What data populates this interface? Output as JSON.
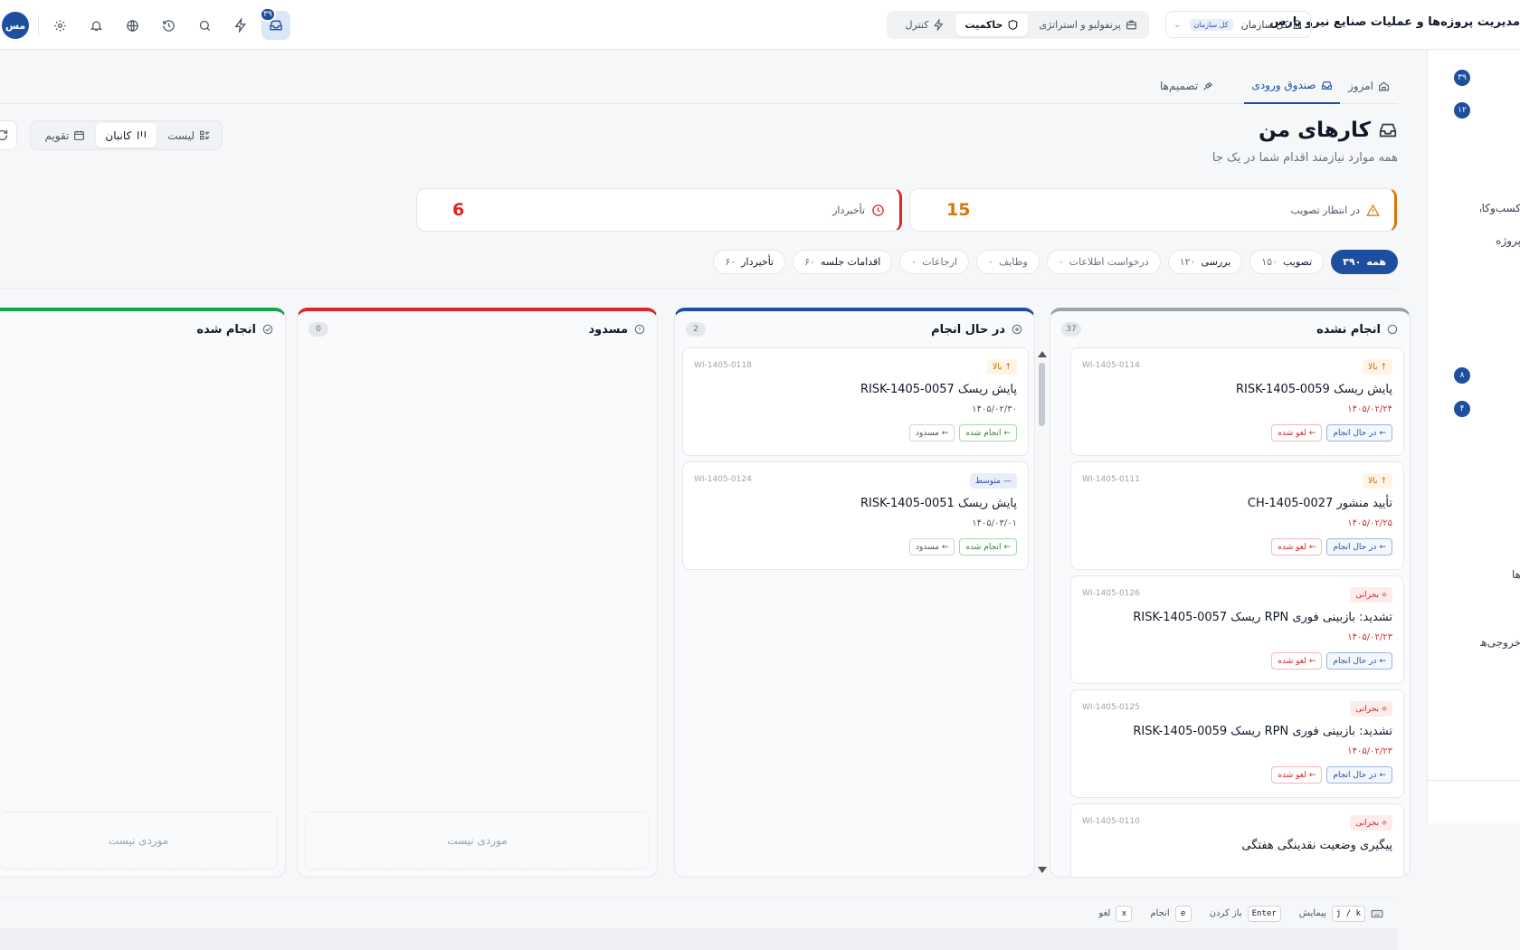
{
  "header": {
    "app_title": "مدیریت پروژه‌ها و عملیات صنایع نیرو پارس",
    "scope_label": "کل سازمان",
    "scope_chip": "کل سازمان",
    "modes": [
      {
        "label": "پرتفولیو و استراتژی",
        "icon": "briefcase-icon"
      },
      {
        "label": "حاکمیت",
        "icon": "shield-icon"
      },
      {
        "label": "کنترل",
        "icon": "bolt-icon"
      }
    ],
    "active_mode": "حاکمیت",
    "inbox_badge": "۳۹",
    "avatar_initials": "مس",
    "icons": [
      "inbox-icon",
      "bolt-icon",
      "search-icon",
      "history-icon",
      "globe-icon",
      "bell-icon",
      "gear-icon"
    ]
  },
  "sidepanel": {
    "badges": [
      "۳۹",
      "۱۲",
      "۸",
      "۴"
    ],
    "texts": [
      "کسب‌وکار",
      "پروژه",
      "ها",
      "خروجی‌ها"
    ]
  },
  "tabs": [
    {
      "label": "امروز",
      "icon": "home-icon"
    },
    {
      "label": "صندوق ورودی",
      "icon": "inbox-icon"
    },
    {
      "label": "تصمیم‌ها",
      "icon": "gavel-icon"
    }
  ],
  "active_tab": "صندوق ورودی",
  "page": {
    "title": "کارهای من",
    "subtitle": "همه موارد نیازمند اقدام شما در یک جا"
  },
  "view_switch": {
    "options": [
      "لیست",
      "کانبان",
      "تقویم"
    ],
    "active": "کانبان"
  },
  "stats": [
    {
      "label": "در انتظار تصویب",
      "value": "15",
      "color": "#d97706",
      "icon": "warning-icon"
    },
    {
      "label": "تأخیردار",
      "value": "6",
      "color": "#dc2626",
      "icon": "clock-icon"
    }
  ],
  "filters": [
    {
      "label": "همه",
      "count": "۳۹۰"
    },
    {
      "label": "تصویب",
      "count": "۱۵۰"
    },
    {
      "label": "بررسی",
      "count": "۱۲۰"
    },
    {
      "label": "درخواست اطلاعات",
      "count": "۰"
    },
    {
      "label": "وظایف",
      "count": "۰"
    },
    {
      "label": "ارجاعات",
      "count": "۰"
    },
    {
      "label": "اقدامات جلسه",
      "count": "۶۰"
    },
    {
      "label": "تأخیردار",
      "count": "۶۰"
    }
  ],
  "active_filter": "همه",
  "kanban": {
    "columns": [
      {
        "title": "انجام نشده",
        "count": "37",
        "color": "#9ca3af",
        "icon": "circle-icon",
        "cards": [
          {
            "priority": "بالا",
            "prio_kind": "high",
            "id": "WI-1405-0114",
            "title": "پایش ریسک RISK-1405-0059",
            "due": "۱۴۰۵/۰۲/۲۴",
            "due_kind": "red",
            "actions": [
              "در حال انجام",
              "لغو شده"
            ]
          },
          {
            "priority": "بالا",
            "prio_kind": "high",
            "id": "WI-1405-0111",
            "title": "تأیید منشور CH-1405-0027",
            "due": "۱۴۰۵/۰۲/۲۵",
            "due_kind": "red",
            "actions": [
              "در حال انجام",
              "لغو شده"
            ]
          },
          {
            "priority": "بحرانی",
            "prio_kind": "crit",
            "id": "WI-1405-0126",
            "title": "تشدید: بازبینی فوری RPN ریسک RISK-1405-0057",
            "due": "۱۴۰۵/۰۲/۲۳",
            "due_kind": "red",
            "actions": [
              "در حال انجام",
              "لغو شده"
            ]
          },
          {
            "priority": "بحرانی",
            "prio_kind": "crit",
            "id": "WI-1405-0125",
            "title": "تشدید: بازبینی فوری RPN ریسک RISK-1405-0059",
            "due": "۱۴۰۵/۰۲/۲۳",
            "due_kind": "red",
            "actions": [
              "در حال انجام",
              "لغو شده"
            ]
          },
          {
            "priority": "بحرانی",
            "prio_kind": "crit",
            "id": "WI-1405-0110",
            "title": "پیگیری وضعیت نقدینگی هفتگی",
            "due": "",
            "due_kind": "red",
            "actions": []
          }
        ]
      },
      {
        "title": "در حال انجام",
        "count": "2",
        "color": "#1e4f9e",
        "icon": "half-circle-icon",
        "cards": [
          {
            "priority": "بالا",
            "prio_kind": "high",
            "id": "WI-1405-0118",
            "title": "پایش ریسک RISK-1405-0057",
            "due": "۱۴۰۵/۰۲/۳۰",
            "due_kind": "gray",
            "actions": [
              "انجام شده",
              "مسدود"
            ]
          },
          {
            "priority": "متوسط",
            "prio_kind": "med",
            "id": "WI-1405-0124",
            "title": "پایش ریسک RISK-1405-0051",
            "due": "۱۴۰۵/۰۳/۰۱",
            "due_kind": "gray",
            "actions": [
              "انجام شده",
              "مسدود"
            ]
          }
        ]
      },
      {
        "title": "مسدود",
        "count": "0",
        "color": "#dc2626",
        "icon": "alert-circle-icon",
        "empty_text": "موردی نیست",
        "cards": []
      },
      {
        "title": "انجام شده",
        "count": "",
        "color": "#16a34a",
        "icon": "check-circle-icon",
        "empty_text": "موردی نیست",
        "cards": []
      }
    ]
  },
  "footer": {
    "shortcuts": [
      {
        "key": "j / k",
        "label": "پیمایش"
      },
      {
        "key": "Enter",
        "label": "باز کردن"
      },
      {
        "key": "e",
        "label": "انجام"
      },
      {
        "key": "x",
        "label": "لغو"
      }
    ]
  }
}
